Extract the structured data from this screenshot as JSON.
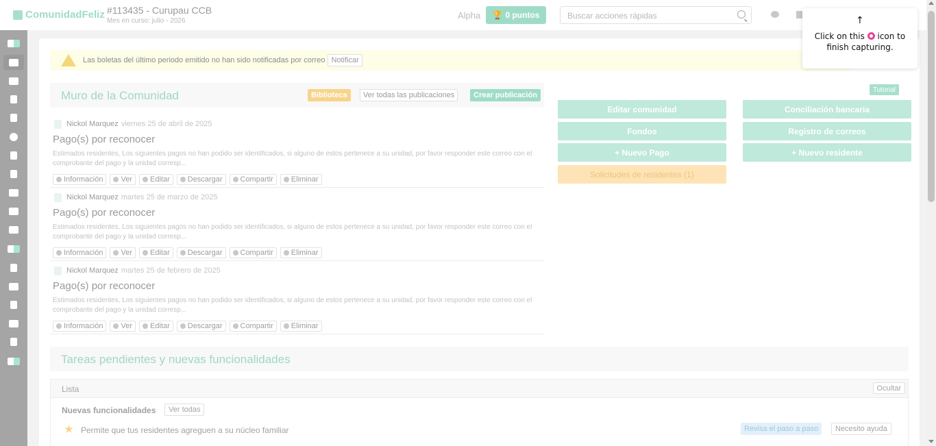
{
  "header": {
    "logo_text": "ComunidadFeliz",
    "community_title": "#113435 - Curupau CCB",
    "period_text": "Mes en curso: julio - 2026",
    "alpha_label": "Alpha",
    "points_label": "0 puntos",
    "search_placeholder": "Buscar acciones rápidas"
  },
  "sidebar": {
    "items": [
      "logo-icon",
      "home-icon",
      "money-icon",
      "document-icon",
      "book-icon",
      "gauge-icon",
      "dollar-icon",
      "receipt-icon",
      "users-icon",
      "briefcase-icon",
      "bank-icon",
      "money-transfer-icon",
      "key-icon",
      "building-icon",
      "calculator-icon",
      "chart-icon",
      "wrench-icon",
      "money-check-icon"
    ],
    "active": "home-icon"
  },
  "warning": {
    "text": "Las boletas del último periodo emitido no han sido notificadas por correo",
    "button": "Notificar"
  },
  "wall": {
    "title": "Muro de la Comunidad",
    "library_label": "Biblioteca",
    "view_all_label": "Ver todas las publicaciones",
    "create_label": "Crear publicación",
    "posts": [
      {
        "author": "Nickol Marquez",
        "date": "viernes 25 de abril de 2025",
        "title": "Pago(s) por reconocer",
        "body": "Estimados residentes, Los siguientes pagos no han podido ser identificados, si alguno de estos pertenece a su unidad, por favor responder este correo con el comprobante del pago y la unidad corresp..."
      },
      {
        "author": "Nickol Marquez",
        "date": "martes 25 de marzo de 2025",
        "title": "Pago(s) por reconocer",
        "body": "Estimados residentes, Los siguientes pagos no han podido ser identificados, si alguno de estos pertenece a su unidad, por favor responder este correo con el comprobante del pago y la unidad corresp..."
      },
      {
        "author": "Nickol Marquez",
        "date": "martes 25 de febrero de 2025",
        "title": "Pago(s) por reconocer",
        "body": "Estimados residentes, Los siguientes pagos no han podido ser identificados, si alguno de estos pertenece a su unidad, por favor responder este correo con el comprobante del pago y la unidad corresp..."
      }
    ],
    "actions": [
      "Información",
      "Ver",
      "Editar",
      "Descargar",
      "Compartir",
      "Eliminar"
    ]
  },
  "quick": {
    "tutorial_label": "Tutorial",
    "edit_community": "Editar comunidad",
    "bank_reconciliation": "Conciliación bancaria",
    "funds": "Fondos",
    "email_log": "Registro de correos",
    "new_payment": "+ Nuevo Pago",
    "new_resident": "+ Nuevo residente",
    "resident_requests": "Solicitudes de residentes (1)"
  },
  "tasks": {
    "title": "Tareas pendientes y nuevas funcionalidades",
    "list_label": "Lista",
    "hide_label": "Ocultar",
    "new_features_label": "Nuevas funcionalidades",
    "view_all_label": "Ver todas",
    "feature_text": "Permite que tus residentes agreguen a su núcleo familiar",
    "step_by_step_label": "Revisa el paso a paso",
    "need_help_label": "Necesito ayuda"
  },
  "capture_tooltip": {
    "arrow": "↑",
    "text_before": "Click on this",
    "text_after": "icon to finish capturing."
  },
  "colors": {
    "brand_green": "#9fdcc8",
    "warning_yellow": "#f8d48a",
    "sidebar_gray": "#a5a5a5",
    "capture_pink": "#e84393"
  }
}
